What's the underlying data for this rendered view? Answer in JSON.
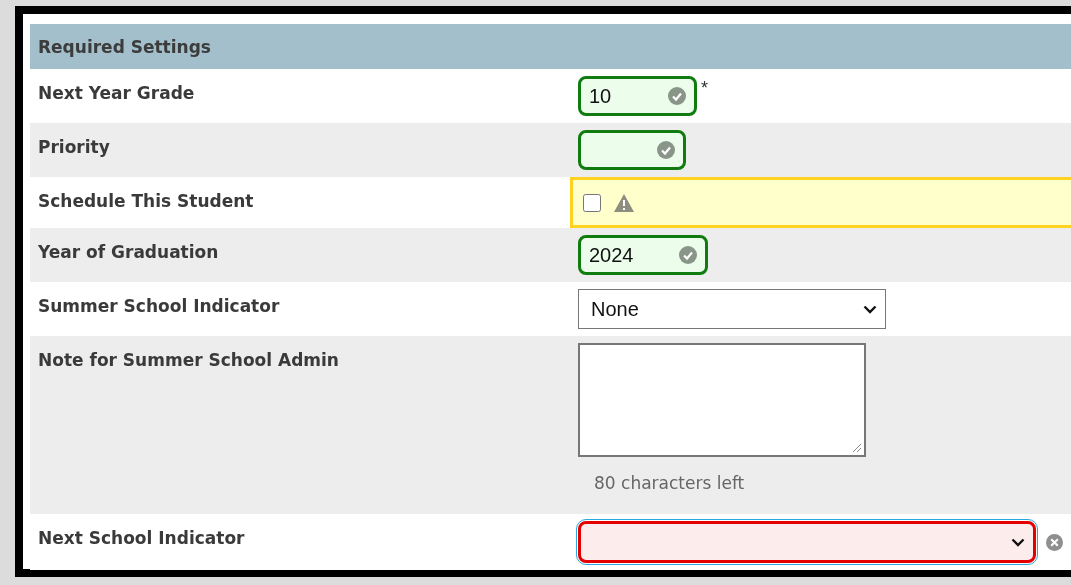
{
  "section": {
    "title": "Required Settings"
  },
  "rows": [
    {
      "label": "Next Year Grade",
      "kind": "text",
      "value": "10",
      "valid": true,
      "warning": false,
      "error": false,
      "focused": false,
      "required_mark": "*"
    },
    {
      "label": "Priority",
      "kind": "text",
      "valid": true,
      "warning": false,
      "error": false,
      "focused": false
    },
    {
      "label": "Schedule This Student",
      "kind": "checkbox",
      "checked": false,
      "valid": false,
      "warning": true,
      "error": false,
      "focused": false
    },
    {
      "label": "Year of Graduation",
      "kind": "text",
      "value": "2024",
      "valid": true,
      "warning": false,
      "error": false,
      "focused": false
    },
    {
      "label": "Summer School Indicator",
      "kind": "select",
      "value": "None",
      "valid": false,
      "warning": false,
      "error": false,
      "focused": false
    },
    {
      "label": "Note for Summer School Admin",
      "kind": "textarea",
      "counter": "80 characters left",
      "valid": false,
      "warning": false,
      "error": false,
      "focused": false
    },
    {
      "label": "Next School Indicator",
      "kind": "select",
      "valid": false,
      "warning": false,
      "error": true,
      "focused": true
    }
  ]
}
